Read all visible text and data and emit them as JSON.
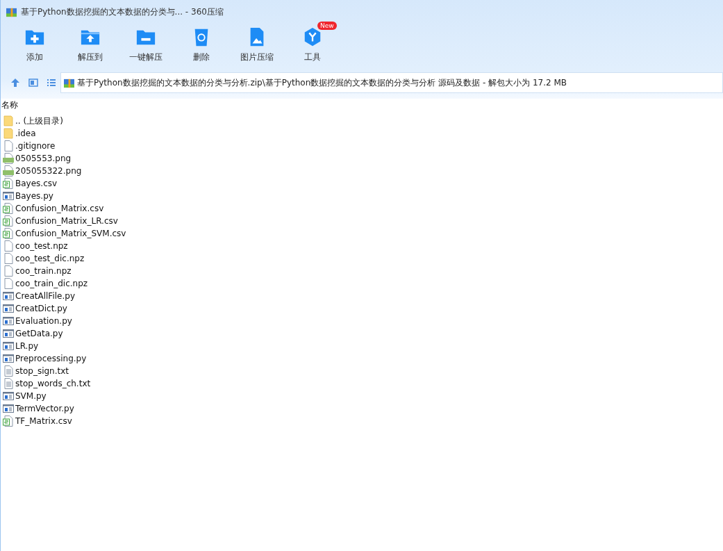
{
  "window": {
    "title": "基于Python数据挖掘的文本数据的分类与... - 360压缩"
  },
  "toolbar": [
    {
      "kind": "add",
      "label": "添加"
    },
    {
      "kind": "extract-to",
      "label": "解压到"
    },
    {
      "kind": "extract",
      "label": "一键解压"
    },
    {
      "kind": "delete",
      "label": "删除"
    },
    {
      "kind": "image",
      "label": "图片压缩"
    },
    {
      "kind": "tools",
      "label": "工具",
      "badge": "New"
    }
  ],
  "address": {
    "path": "基于Python数据挖掘的文本数据的分类与分析.zip\\基于Python数据挖掘的文本数据的分类与分析 源码及数据 - 解包大小为 17.2 MB"
  },
  "list": {
    "columns": [
      "名称"
    ],
    "rows": [
      {
        "kind": "folder",
        "name": ".. (上级目录)"
      },
      {
        "kind": "folder",
        "name": ".idea"
      },
      {
        "kind": "file",
        "name": ".gitignore"
      },
      {
        "kind": "png",
        "name": "0505553.png"
      },
      {
        "kind": "png",
        "name": "205055322.png"
      },
      {
        "kind": "csv",
        "name": "Bayes.csv"
      },
      {
        "kind": "py",
        "name": "Bayes.py"
      },
      {
        "kind": "csv",
        "name": "Confusion_Matrix.csv"
      },
      {
        "kind": "csv",
        "name": "Confusion_Matrix_LR.csv"
      },
      {
        "kind": "csv",
        "name": "Confusion_Matrix_SVM.csv"
      },
      {
        "kind": "file",
        "name": "coo_test.npz"
      },
      {
        "kind": "file",
        "name": "coo_test_dic.npz"
      },
      {
        "kind": "file",
        "name": "coo_train.npz"
      },
      {
        "kind": "file",
        "name": "coo_train_dic.npz"
      },
      {
        "kind": "py",
        "name": "CreatAllFile.py"
      },
      {
        "kind": "py",
        "name": "CreatDict.py"
      },
      {
        "kind": "py",
        "name": "Evaluation.py"
      },
      {
        "kind": "py",
        "name": "GetData.py"
      },
      {
        "kind": "py",
        "name": "LR.py"
      },
      {
        "kind": "py",
        "name": "Preprocessing.py"
      },
      {
        "kind": "txt",
        "name": "stop_sign.txt"
      },
      {
        "kind": "txt",
        "name": "stop_words_ch.txt"
      },
      {
        "kind": "py",
        "name": "SVM.py"
      },
      {
        "kind": "py",
        "name": "TermVector.py"
      },
      {
        "kind": "csv",
        "name": "TF_Matrix.csv"
      }
    ]
  }
}
